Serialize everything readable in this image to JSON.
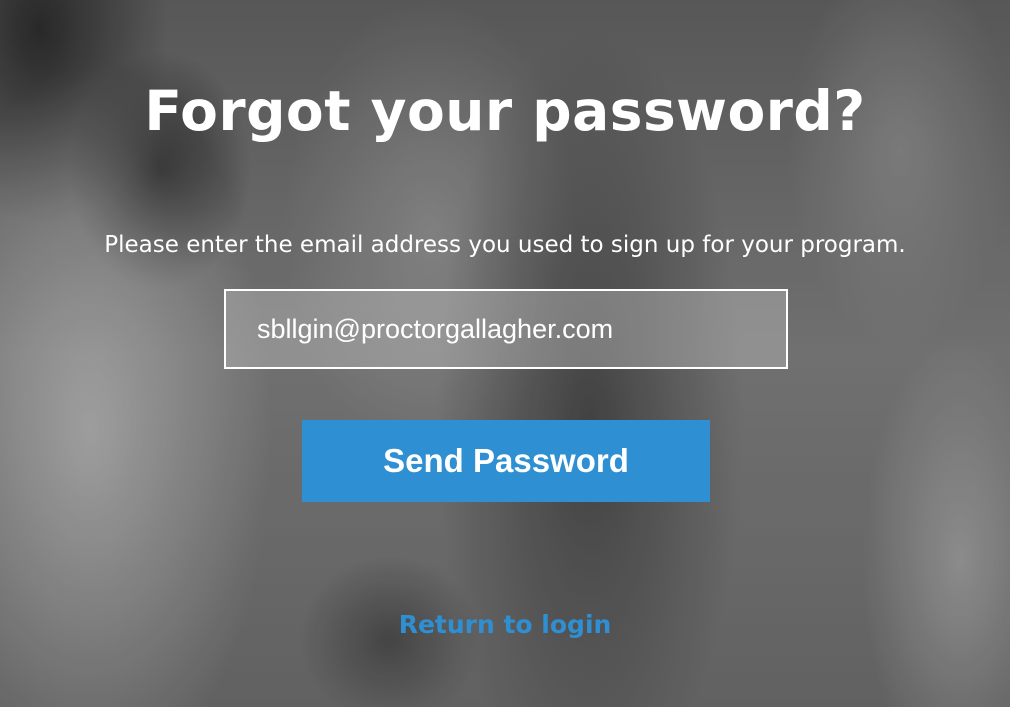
{
  "page": {
    "title": "Forgot your password?",
    "instruction": "Please enter the email address you used to sign up for your program."
  },
  "form": {
    "email_value": "sbllgin@proctorgallagher.com",
    "submit_label": "Send Password"
  },
  "links": {
    "return_label": "Return to login"
  },
  "colors": {
    "accent": "#2e8fd3",
    "text": "#ffffff"
  }
}
